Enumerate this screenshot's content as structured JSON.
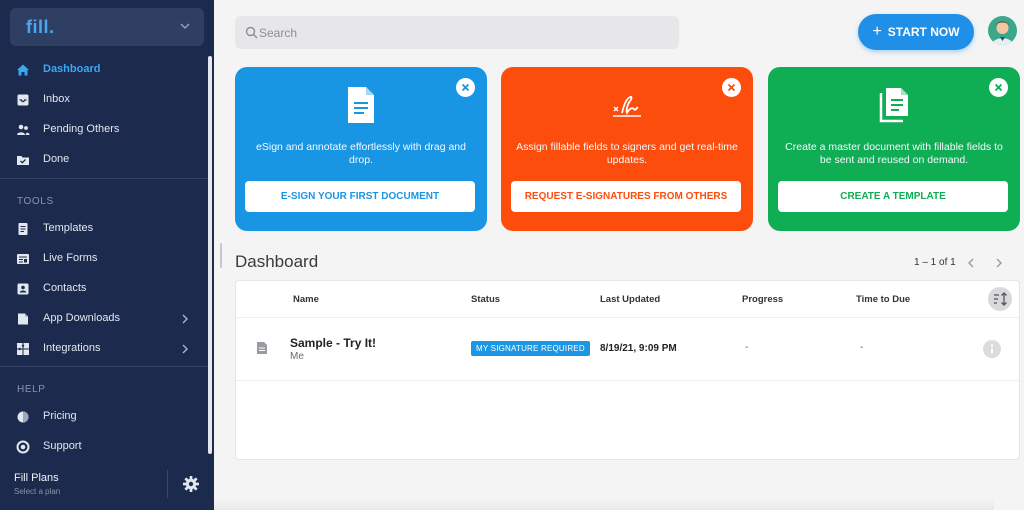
{
  "sidebar": {
    "logo": "fill.",
    "main_items": [
      {
        "label": "Dashboard",
        "icon": "home-icon",
        "active": true
      },
      {
        "label": "Inbox",
        "icon": "inbox-icon"
      },
      {
        "label": "Pending Others",
        "icon": "users-icon"
      },
      {
        "label": "Done",
        "icon": "folder-check-icon"
      }
    ],
    "tools_label": "TOOLS",
    "tools_items": [
      {
        "label": "Templates",
        "icon": "templates-icon"
      },
      {
        "label": "Live Forms",
        "icon": "forms-icon"
      },
      {
        "label": "Contacts",
        "icon": "contacts-icon"
      },
      {
        "label": "App Downloads",
        "icon": "download-icon"
      },
      {
        "label": "Integrations",
        "icon": "puzzle-icon"
      }
    ],
    "help_label": "HELP",
    "help_items": [
      {
        "label": "Pricing",
        "icon": "pricing-icon"
      },
      {
        "label": "Support",
        "icon": "support-icon"
      }
    ],
    "plans": {
      "title": "Fill Plans",
      "subtitle": "Select a plan"
    }
  },
  "header": {
    "search_placeholder": "Search",
    "start_button": "START NOW"
  },
  "cards": [
    {
      "description": "eSign and annotate effortlessly with drag and drop.",
      "cta": "E-SIGN YOUR FIRST DOCUMENT",
      "color": "#1996e3"
    },
    {
      "description": "Assign fillable fields to signers and get real-time updates.",
      "cta": "REQUEST E-SIGNATURES FROM OTHERS",
      "color": "#fc4d0d"
    },
    {
      "description": "Create a master document with fillable fields to be sent and reused on demand.",
      "cta": "CREATE A TEMPLATE",
      "color": "#0fae54"
    }
  ],
  "dashboard": {
    "title": "Dashboard",
    "pagination": "1 – 1 of 1",
    "columns": [
      "Name",
      "Status",
      "Last Updated",
      "Progress",
      "Time to Due"
    ],
    "rows": [
      {
        "name": "Sample - Try It!",
        "owner": "Me",
        "status": "MY SIGNATURE REQUIRED",
        "last_updated": "8/19/21, 9:09 PM",
        "progress": "-",
        "time_to_due": "-"
      }
    ]
  }
}
